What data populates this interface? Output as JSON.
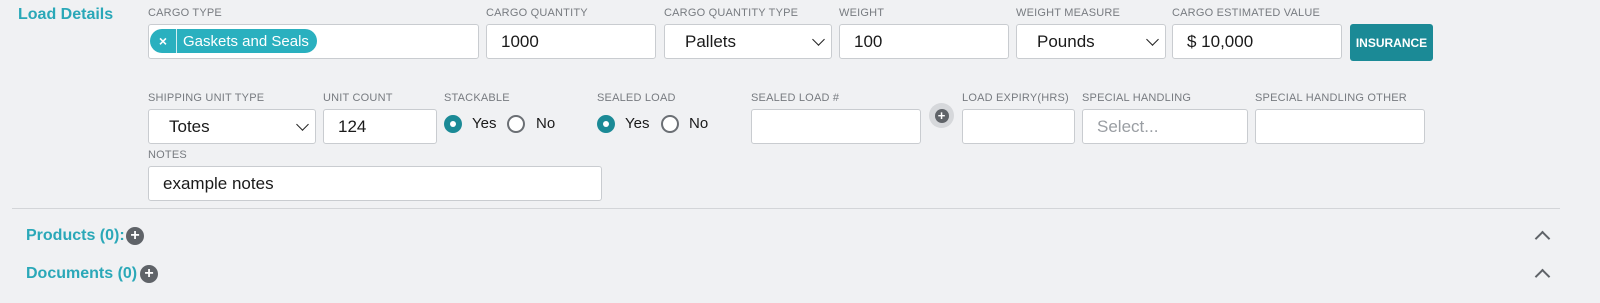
{
  "load_details": {
    "title": "Load Details",
    "cargo_type": {
      "label": "CARGO TYPE",
      "tags": [
        "Gaskets and Seals"
      ],
      "remove_symbol": "×"
    },
    "cargo_quantity": {
      "label": "CARGO QUANTITY",
      "value": "1000"
    },
    "cargo_quantity_type": {
      "label": "CARGO QUANTITY TYPE",
      "value": "Pallets"
    },
    "weight": {
      "label": "WEIGHT",
      "value": "100"
    },
    "weight_measure": {
      "label": "WEIGHT MEASURE",
      "value": "Pounds"
    },
    "cargo_estimated_value": {
      "label": "CARGO ESTIMATED VALUE",
      "value": "$ 10,000"
    },
    "insurance_button": "INSURANCE",
    "shipping_unit_type": {
      "label": "SHIPPING UNIT TYPE",
      "value": "Totes"
    },
    "unit_count": {
      "label": "UNIT COUNT",
      "value": "124"
    },
    "stackable": {
      "label": "STACKABLE",
      "yes": "Yes",
      "no": "No",
      "selected": "Yes"
    },
    "sealed_load": {
      "label": "SEALED LOAD",
      "yes": "Yes",
      "no": "No",
      "selected": "Yes"
    },
    "sealed_load_number": {
      "label": "SEALED LOAD #",
      "value": ""
    },
    "load_expiry": {
      "label": "LOAD EXPIRY(HRS)",
      "value": ""
    },
    "special_handling": {
      "label": "SPECIAL HANDLING",
      "placeholder": "Select..."
    },
    "special_handling_other": {
      "label": "SPECIAL HANDLING OTHER",
      "value": ""
    },
    "notes": {
      "label": "NOTES",
      "value": "example notes"
    }
  },
  "products": {
    "title": "Products (0):"
  },
  "documents": {
    "title": "Documents (0)"
  },
  "icons": {
    "add": "plus-circle-icon",
    "collapse": "chevron-up-icon",
    "select": "chevron-down-icon",
    "remove": "close-icon"
  },
  "colors": {
    "accent": "#2aa8b8",
    "button": "#1b8a96",
    "background": "#f0f1f3"
  }
}
